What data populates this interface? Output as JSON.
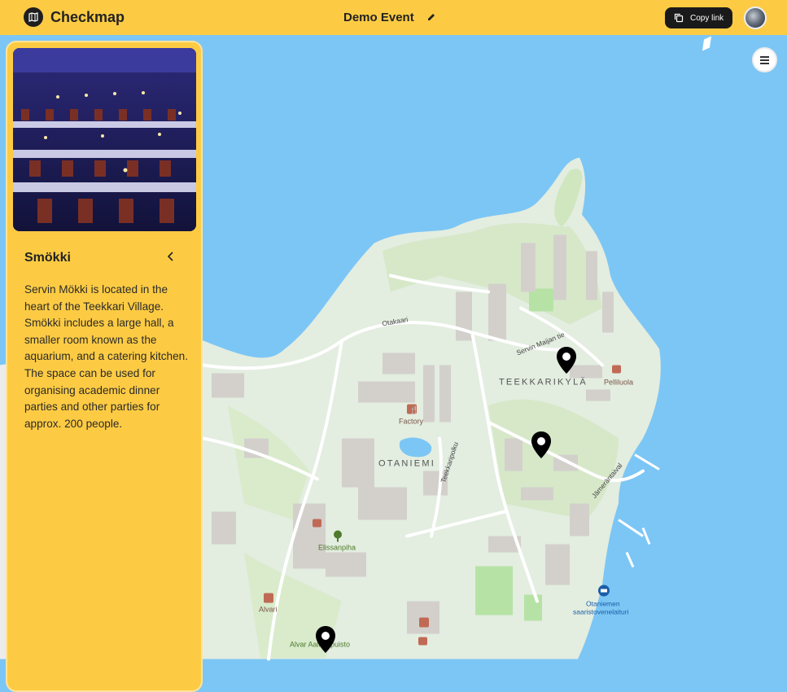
{
  "header": {
    "app_name": "Checkmap",
    "event_name": "Demo Event",
    "copy_link_label": "Copy link",
    "logo_icon": "map-icon",
    "edit_icon": "pencil-icon",
    "accent_color": "#fdcb43"
  },
  "sidebar": {
    "title": "Smökki",
    "description": "Servin Mökki is located in the heart of the Teekkari Village. Smökki includes a large hall, a smaller room known as the aquarium, and a catering kitchen. The space can be used for organising academic dinner parties and other parties for approx. 200 people.",
    "back_icon": "chevron-left-icon"
  },
  "map": {
    "labels": {
      "teekkarikyla": "TEEKKARIKYLÄ",
      "otaniemi": "OTANIEMI",
      "factory": "Factory",
      "pelliluola": "Pelliluola",
      "elissanpiha": "Elissanpiha",
      "alvari": "Alvari",
      "alvar_park": "Alvar Aallon puisto",
      "otakaari": "Otakaari",
      "servin_maijan": "Servin Maijan tie",
      "teekkaripolku": "Teekkaripolku",
      "jamerantaival": "Jämeräntaival",
      "ferry1": "Otaniemen",
      "ferry2": "saaristovenelaituri"
    }
  }
}
